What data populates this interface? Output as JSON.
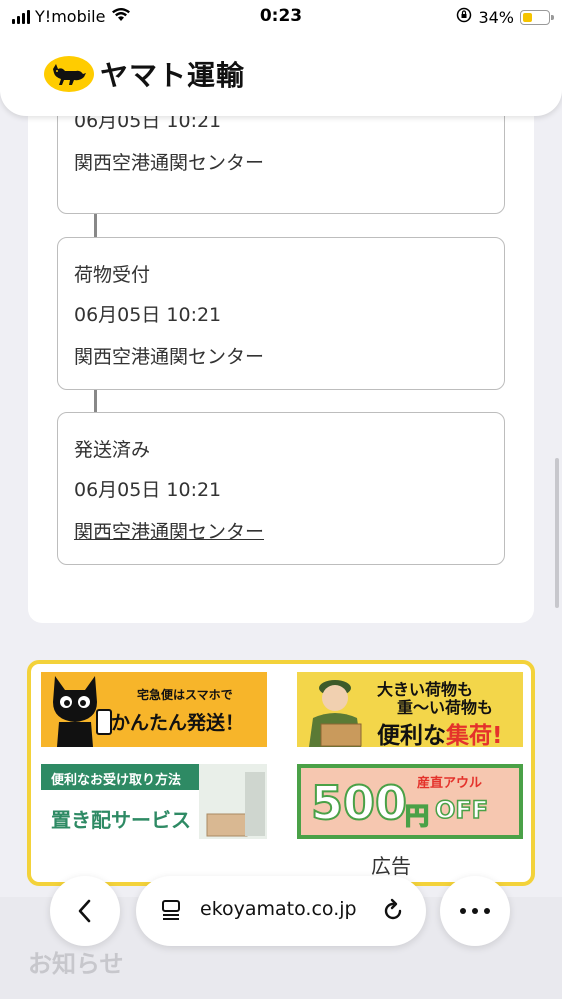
{
  "status_bar": {
    "carrier": "Y!mobile",
    "time": "0:23",
    "battery_percent": "34%",
    "battery_level": 0.34
  },
  "header": {
    "logo_text": "ヤマト運輸"
  },
  "tracking": {
    "steps": [
      {
        "title": "",
        "datetime": "06月05日 10:21",
        "place": "関西空港通関センター"
      },
      {
        "title": "荷物受付",
        "datetime": "06月05日 10:21",
        "place": "関西空港通関センター"
      },
      {
        "title": "発送済み",
        "datetime": "06月05日 10:21",
        "place": "関西空港通関センター"
      }
    ]
  },
  "ads": {
    "ad1": {
      "line1": "宅急便はスマホで",
      "line2": "かんたん発送！"
    },
    "ad2": {
      "line1": "大きい荷物も",
      "line2": "重〜い荷物も",
      "line3a": "便利な",
      "line3b": "集荷!"
    },
    "ad3": {
      "line1": "便利なお受け取り方法",
      "line2": "置き配サービス"
    },
    "ad4": {
      "small": "産直アウル",
      "big": "500",
      "yen": "円",
      "off": "OFF"
    },
    "label": "広告"
  },
  "browser": {
    "url": "ekoyamato.co.jp",
    "notice": "お知らせ"
  },
  "colors": {
    "brand_yellow": "#ffcc00",
    "ad_border": "#f3d23a",
    "ad_red": "#e4322b"
  }
}
